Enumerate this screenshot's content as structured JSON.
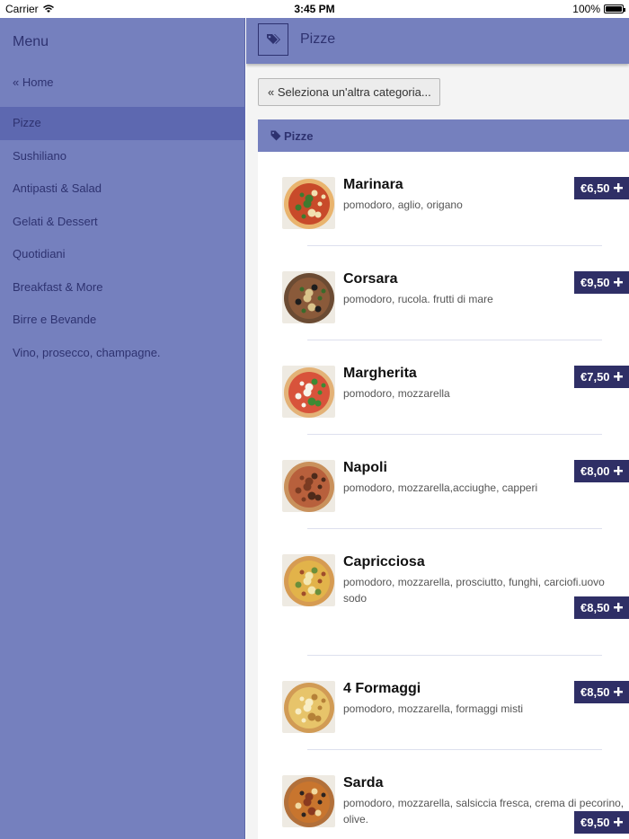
{
  "status_bar": {
    "carrier": "Carrier",
    "time": "3:45 PM",
    "battery": "100%"
  },
  "sidebar": {
    "title": "Menu",
    "home": "« Home",
    "items": [
      {
        "label": "Pizze",
        "active": true
      },
      {
        "label": "Sushiliano",
        "active": false
      },
      {
        "label": "Antipasti & Salad",
        "active": false
      },
      {
        "label": "Gelati & Dessert",
        "active": false
      },
      {
        "label": "Quotidiani",
        "active": false
      },
      {
        "label": "Breakfast & More",
        "active": false
      },
      {
        "label": "Birre e Bevande",
        "active": false
      },
      {
        "label": "Vino, prosecco, champagne.",
        "active": false
      }
    ]
  },
  "header": {
    "title": "Pizze",
    "tag_icon": "tags-icon"
  },
  "back_button": "« Seleziona un'altra categoria...",
  "category": {
    "title": "Pizze",
    "icon": "tag-icon"
  },
  "products": [
    {
      "name": "Marinara",
      "description": "pomodoro, aglio, origano",
      "price": "€6,50"
    },
    {
      "name": "Corsara",
      "description": "pomodoro, rucola. frutti di mare",
      "price": "€9,50"
    },
    {
      "name": "Margherita",
      "description": "pomodoro, mozzarella",
      "price": "€7,50"
    },
    {
      "name": "Napoli",
      "description": "pomodoro, mozzarella,acciughe, capperi",
      "price": "€8,00"
    },
    {
      "name": "Capricciosa",
      "description": "pomodoro, mozzarella, prosciutto, funghi, carciofi.uovo sodo",
      "price": "€8,50"
    },
    {
      "name": "4 Formaggi",
      "description": "pomodoro, mozzarella, formaggi misti",
      "price": "€8,50"
    },
    {
      "name": "Sarda",
      "description": "pomodoro, mozzarella, salsiccia fresca, crema di pecorino, olive.",
      "price": "€9,50"
    }
  ],
  "colors": {
    "accent": "#7580be",
    "dark": "#2e3270",
    "price_bg": "#2f2f66"
  }
}
